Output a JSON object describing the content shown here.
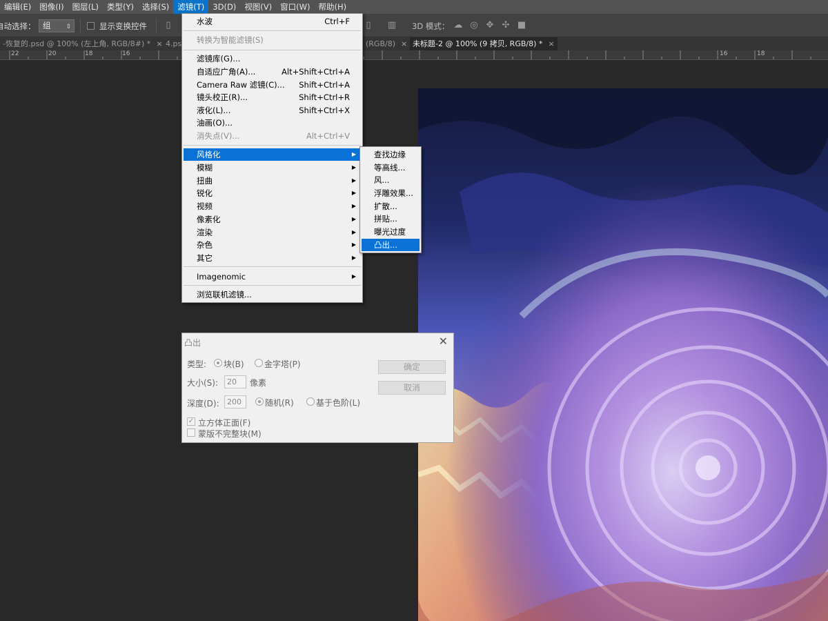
{
  "menubar": {
    "items": [
      "编辑(E)",
      "图像(I)",
      "图层(L)",
      "类型(Y)",
      "选择(S)",
      "滤镜(T)",
      "3D(D)",
      "视图(V)",
      "窗口(W)",
      "帮助(H)"
    ],
    "active_index": 5
  },
  "options": {
    "auto_select_label": "自动选择：",
    "auto_select_value": "组",
    "show_transform_label": "显示变换控件",
    "mode_3d_label": "3D 模式："
  },
  "tabs": [
    {
      "label": "-恢复的.psd @ 100% (左上角, RGB/8#) *",
      "close": "×"
    },
    {
      "label": "4.ps",
      "close": ""
    },
    {
      "label": "(RGB/8)",
      "close": "×"
    },
    {
      "label": "未标题-2 @ 100% (9 拷贝, RGB/8) *",
      "close": "×"
    }
  ],
  "ruler": [
    "22",
    "20",
    "18",
    "16",
    "16",
    "18"
  ],
  "filter_menu": {
    "last_filter": {
      "label": "水波",
      "shortcut": "Ctrl+F"
    },
    "convert_smart": "转换为智能滤镜(S)",
    "filter_gallery": "滤镜库(G)...",
    "adaptive_wide": {
      "label": "自适应广角(A)...",
      "shortcut": "Alt+Shift+Ctrl+A"
    },
    "camera_raw": {
      "label": "Camera Raw 滤镜(C)...",
      "shortcut": "Shift+Ctrl+A"
    },
    "lens_correction": {
      "label": "镜头校正(R)...",
      "shortcut": "Shift+Ctrl+R"
    },
    "liquify": {
      "label": "液化(L)...",
      "shortcut": "Shift+Ctrl+X"
    },
    "oil_paint": "油画(O)...",
    "vanishing_point": {
      "label": "消失点(V)...",
      "shortcut": "Alt+Ctrl+V"
    },
    "groups": [
      "风格化",
      "模糊",
      "扭曲",
      "锐化",
      "视频",
      "像素化",
      "渲染",
      "杂色",
      "其它"
    ],
    "imagenomic": "Imagenomic",
    "browse_online": "浏览联机滤镜..."
  },
  "stylize_submenu": [
    "查找边缘",
    "等高线...",
    "风...",
    "浮雕效果...",
    "扩散...",
    "拼贴...",
    "曝光过度",
    "凸出..."
  ],
  "dialog": {
    "title": "凸出",
    "type_label": "类型:",
    "type_block": "块(B)",
    "type_pyramid": "金字塔(P)",
    "size_label": "大小(S):",
    "size_value": "20",
    "size_unit": "像素",
    "depth_label": "深度(D):",
    "depth_value": "200",
    "depth_random": "随机(R)",
    "depth_level": "基于色阶(L)",
    "solid_front": "立方体正面(F)",
    "mask_incomplete": "蒙版不完整块(M)",
    "ok": "确定",
    "cancel": "取消"
  }
}
